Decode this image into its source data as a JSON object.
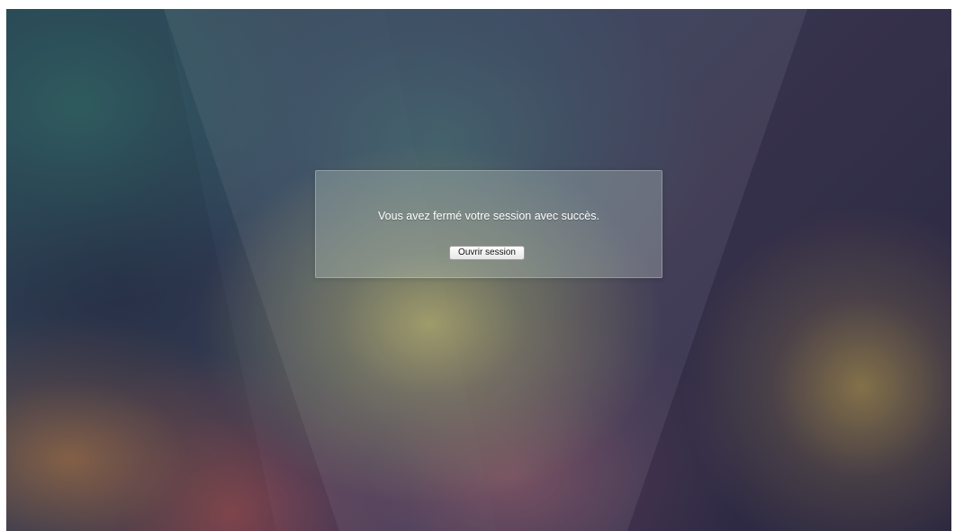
{
  "logout_dialog": {
    "message": "Vous avez fermé votre session avec succès.",
    "login_button_label": "Ouvrir session"
  }
}
